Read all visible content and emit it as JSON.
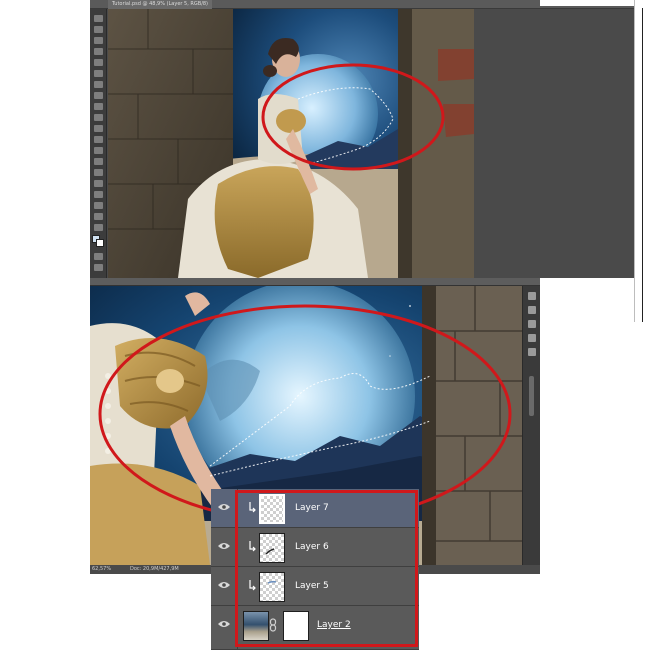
{
  "document": {
    "tab_title": "Tutorial.psd @ 48,9% (Layer 5, RGB/8)"
  },
  "status": {
    "zoom": "62,57%",
    "doc_size": "Doc: 20,9M/427,9M"
  },
  "layers": [
    {
      "name": "Layer 7",
      "selected": true,
      "clipped": true,
      "has_mask": false
    },
    {
      "name": "Layer 6",
      "selected": false,
      "clipped": true,
      "has_mask": false
    },
    {
      "name": "Layer 5",
      "selected": false,
      "clipped": true,
      "has_mask": false
    },
    {
      "name": "Layer 2",
      "selected": false,
      "clipped": false,
      "has_mask": true
    }
  ],
  "colors": {
    "highlight_ellipse": "#d0181b",
    "selected_layer": "#5a6479",
    "panel_bg": "#5a5a5a",
    "app_chrome": "#3c3c3c"
  },
  "icons": {
    "visibility": "eye-icon",
    "clipping": "clipping-mask-arrow-icon",
    "link": "chain-link-icon"
  }
}
